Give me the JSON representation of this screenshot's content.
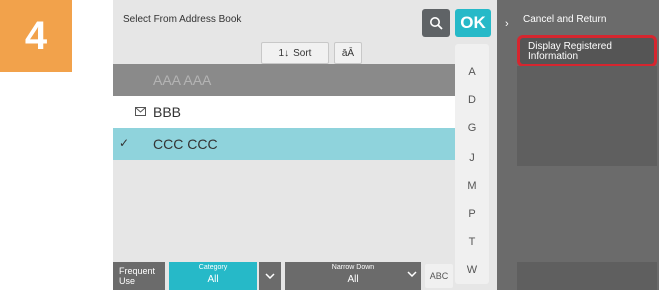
{
  "step_number": "4",
  "panel": {
    "title": "Select From Address Book",
    "ok_label": "OK",
    "sort_label": "Sort",
    "sort_icon": "1↓",
    "aa_label": "āĀ"
  },
  "list": {
    "rows": [
      {
        "name": "AAA AAA"
      },
      {
        "name": "BBB"
      },
      {
        "name": "CCC CCC"
      }
    ]
  },
  "index": [
    "A",
    "D",
    "G",
    "J",
    "M",
    "P",
    "T",
    "W"
  ],
  "footer": {
    "frequent_use": "Frequent Use",
    "category_label": "Category",
    "category_value": "All",
    "narrow_label": "Narrow Down",
    "narrow_value": "All",
    "abc_label": "ABC"
  },
  "side_menu": {
    "cancel_label": "Cancel and Return",
    "display_label": "Display Registered Information"
  },
  "colors": {
    "accent": "#26b9c8",
    "highlight_border": "#d6262f",
    "step_badge": "#f2a24b"
  }
}
